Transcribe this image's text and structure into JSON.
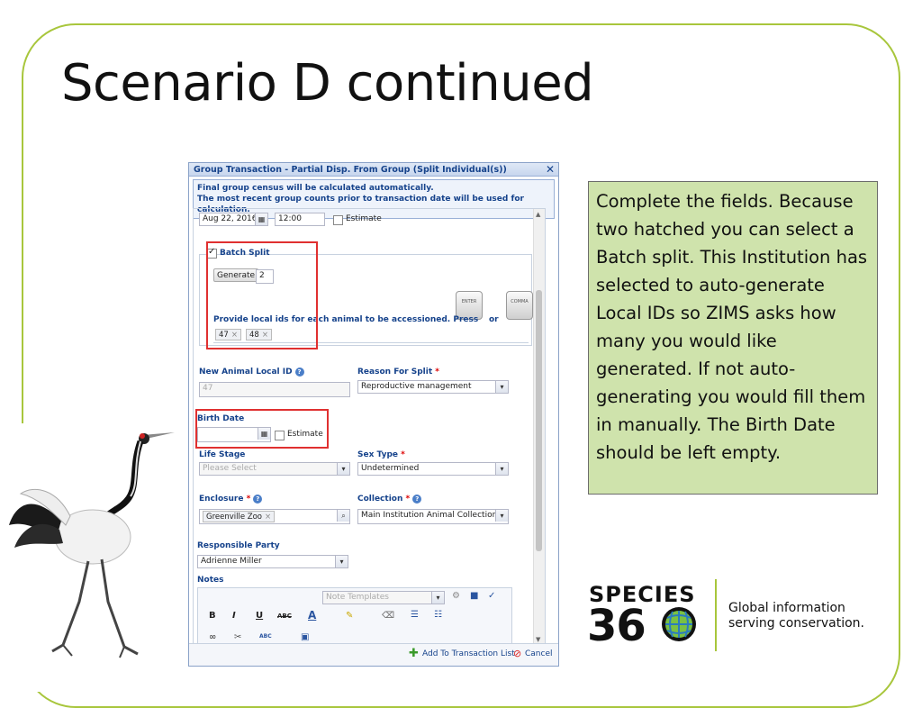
{
  "slide": {
    "title": "Scenario D continued"
  },
  "dialog": {
    "title": "Group Transaction - Partial Disp. From Group (Split Individual(s))",
    "close_glyph": "✕",
    "info_line1": "Final group census will be calculated automatically.",
    "info_line2": "The most recent group counts prior to transaction date will be used for calculation.",
    "date_value": "Aug 22, 2016",
    "time_value": "12:00",
    "estimate_label": "Estimate",
    "batch_split": {
      "label": "Batch Split",
      "checked": true,
      "generate_label": "Generate",
      "count_value": "2",
      "provide_text": "Provide local ids for each animal to be accessioned. Press",
      "or_text": "or",
      "enter_key": "ENTER",
      "comma_key": "COMMA",
      "ids": [
        "47",
        "48"
      ]
    },
    "new_animal_local_id": {
      "label": "New Animal Local ID",
      "value": "47"
    },
    "reason_for_split": {
      "label": "Reason For Split",
      "value": "Reproductive management"
    },
    "birth_date": {
      "label": "Birth Date",
      "value": "",
      "estimate_label": "Estimate"
    },
    "life_stage": {
      "label": "Life Stage",
      "placeholder": "Please Select"
    },
    "sex_type": {
      "label": "Sex Type",
      "value": "Undetermined"
    },
    "enclosure": {
      "label": "Enclosure",
      "value": "Greenville Zoo"
    },
    "collection": {
      "label": "Collection",
      "value": "Main Institution Animal Collection"
    },
    "responsible_party": {
      "label": "Responsible Party",
      "value": "Adrienne Miller"
    },
    "notes": {
      "label": "Notes",
      "templates_placeholder": "Note Templates",
      "toolbar": {
        "bold": "B",
        "italic": "I",
        "underline": "U",
        "strike": "ABC",
        "font_color": "A",
        "spell": "ABC"
      }
    },
    "footer": {
      "add_label": "Add To Transaction List",
      "cancel_label": "Cancel"
    },
    "required_mark": "*",
    "help_glyph": "?"
  },
  "callout": {
    "text": "Complete the fields. Because two hatched you can select a Batch split. This Institution has selected to auto-generate Local IDs so ZIMS asks how many you would like generated. If not auto-generating you would fill them in manually. The Birth Date should be left empty."
  },
  "logo": {
    "word": "SPECIES",
    "number_prefix": "36",
    "tagline_line1": "Global information",
    "tagline_line2": "serving conservation."
  },
  "colors": {
    "frame_green": "#a8c63c",
    "callout_bg": "#cfe3ac",
    "highlight_red": "#e03030",
    "label_blue": "#15428b"
  }
}
